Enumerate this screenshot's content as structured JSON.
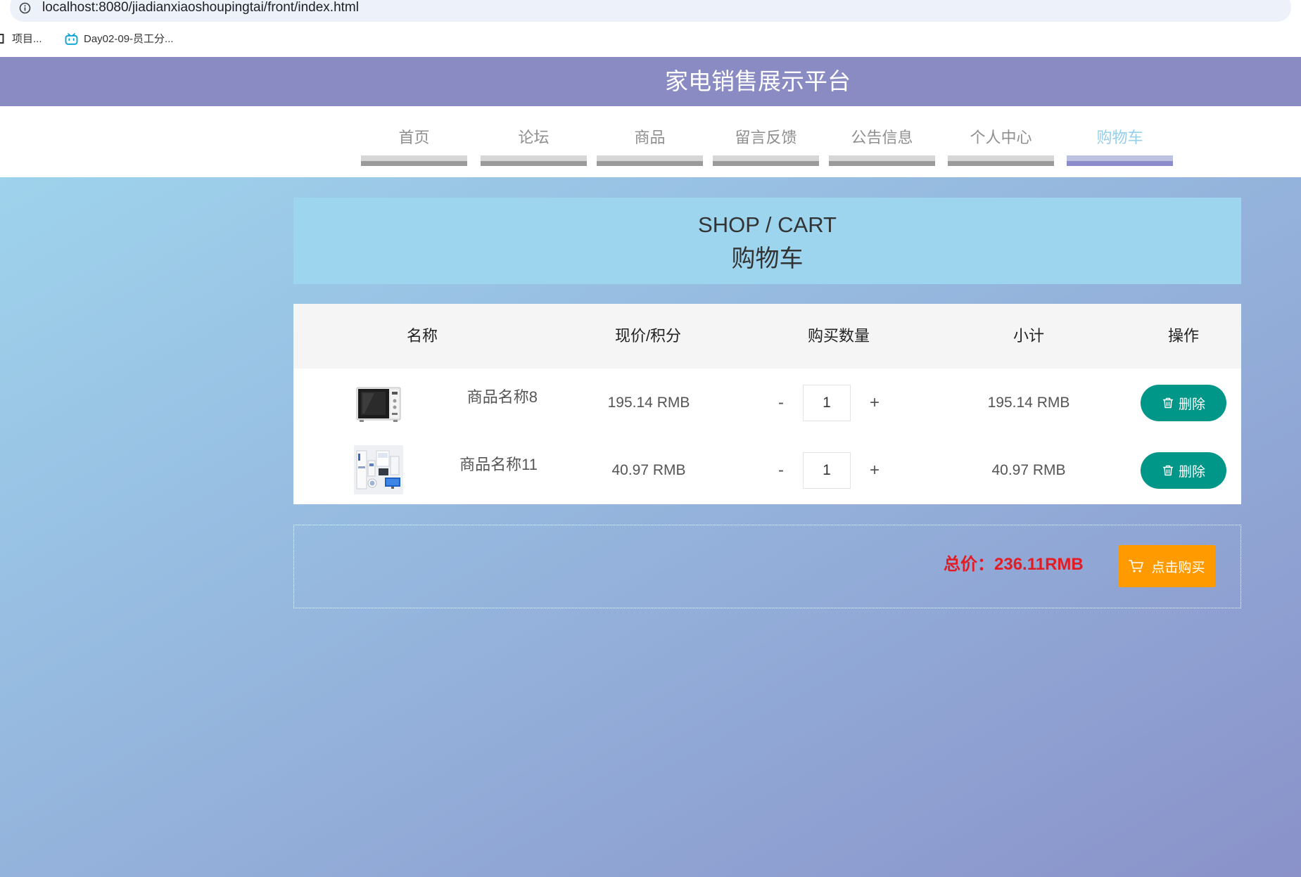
{
  "browser": {
    "url": "localhost:8080/jiadianxiaoshoupingtai/front/index.html",
    "bookmarks": [
      {
        "label": "项目...",
        "icon": "bookmark-favicon-icon"
      },
      {
        "label": "Day02-09-员工分...",
        "icon": "bilibili-tv-icon"
      }
    ]
  },
  "header": {
    "title": "家电销售展示平台"
  },
  "nav": {
    "items": [
      {
        "label": "首页",
        "active": false
      },
      {
        "label": "论坛",
        "active": false
      },
      {
        "label": "商品",
        "active": false
      },
      {
        "label": "留言反馈",
        "active": false
      },
      {
        "label": "公告信息",
        "active": false
      },
      {
        "label": "个人中心",
        "active": false
      },
      {
        "label": "购物车",
        "active": true
      }
    ]
  },
  "cart": {
    "title_en": "SHOP / CART",
    "title_cn": "购物车",
    "columns": [
      "名称",
      "现价/积分",
      "购买数量",
      "小计",
      "操作"
    ],
    "rows": [
      {
        "name": "商品名称8",
        "price": "195.14 RMB",
        "minus": "-",
        "qty": "1",
        "plus": "+",
        "subtotal": "195.14 RMB",
        "delete_label": "删除"
      },
      {
        "name": "商品名称11",
        "price": "40.97 RMB",
        "minus": "-",
        "qty": "1",
        "plus": "+",
        "subtotal": "40.97 RMB",
        "delete_label": "删除"
      }
    ],
    "total": "总价：236.11RMB",
    "buy_label": "点击购买",
    "icons": {
      "delete": "trash-icon",
      "buy": "cart-icon"
    }
  },
  "colors": {
    "header_bg": "#8b8bc4",
    "nav_active_text": "#94cfec",
    "nav_active_bar": "#8b8cc9",
    "title_box_bg": "#9dd4ee",
    "delete_button": "#009688",
    "buy_button": "#ff9b00",
    "total_price": "#e31b23"
  }
}
